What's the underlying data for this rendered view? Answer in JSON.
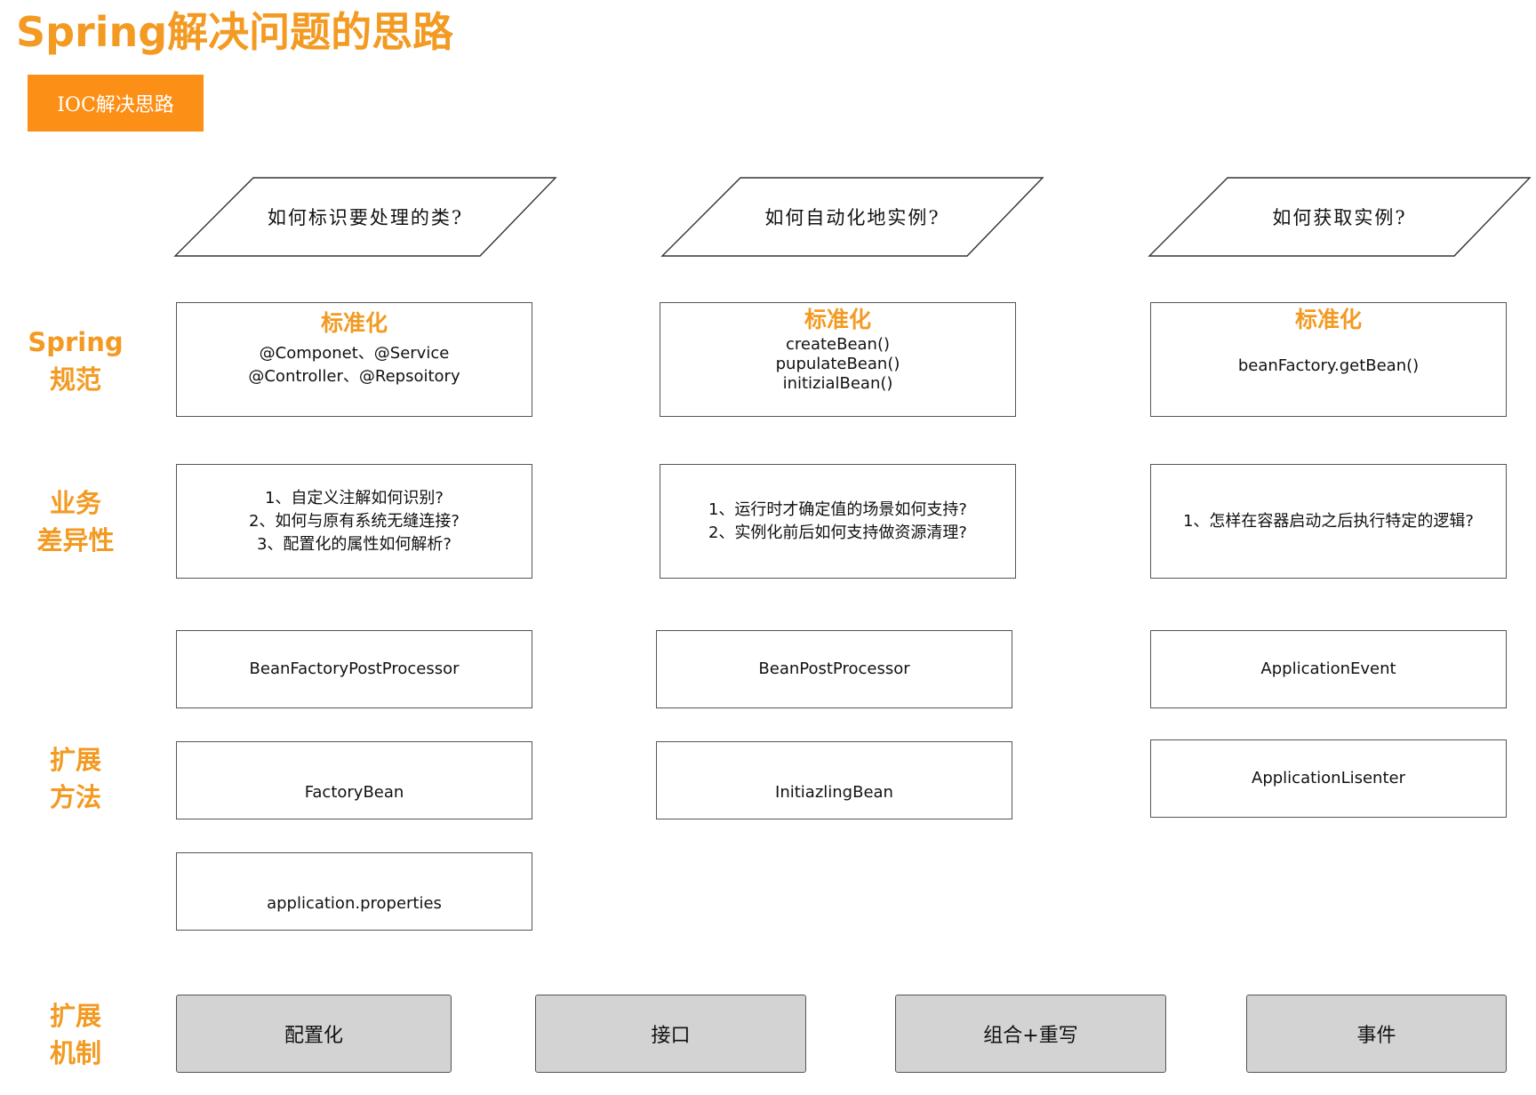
{
  "title": "Spring解决问题的思路",
  "badge": "IOC解决思路",
  "questions": [
    "如何标识要处理的类?",
    "如何自动化地实例?",
    "如何获取实例?"
  ],
  "row_labels": {
    "spec": [
      "Spring",
      "规范"
    ],
    "business": [
      "业务",
      "差异性"
    ],
    "extension_method": [
      "扩展",
      "方法"
    ],
    "extension_mechanism": [
      "扩展",
      "机制"
    ]
  },
  "spec_boxes": [
    {
      "head": "标准化",
      "lines": [
        "@Componet、@Service",
        "@Controller、@Repsoitory"
      ]
    },
    {
      "head": "标准化",
      "lines": [
        "createBean()",
        "pupulateBean()",
        "initizialBean()"
      ]
    },
    {
      "head": "标准化",
      "lines": [
        "beanFactory.getBean()"
      ]
    }
  ],
  "business_boxes": [
    {
      "lines": [
        "1、自定义注解如何识别?",
        "2、如何与原有系统无缝连接?",
        "3、配置化的属性如何解析?"
      ]
    },
    {
      "lines": [
        "1、运行时才确定值的场景如何支持?",
        "2、实例化前后如何支持做资源清理?"
      ]
    },
    {
      "lines": [
        "1、怎样在容器启动之后执行特定的逻辑?"
      ]
    }
  ],
  "extension_boxes": {
    "col1": [
      "BeanFactoryPostProcessor",
      "FactoryBean",
      "application.properties"
    ],
    "col2": [
      "BeanPostProcessor",
      "InitiazlingBean"
    ],
    "col3": [
      "ApplicationEvent",
      "ApplicationLisenter"
    ]
  },
  "mechanisms": [
    "配置化",
    "接口",
    "组合+重写",
    "事件"
  ],
  "colors": {
    "accent": "#f39a22",
    "badge": "#fc8f16",
    "mechanism_fill": "#d3d3d3"
  }
}
